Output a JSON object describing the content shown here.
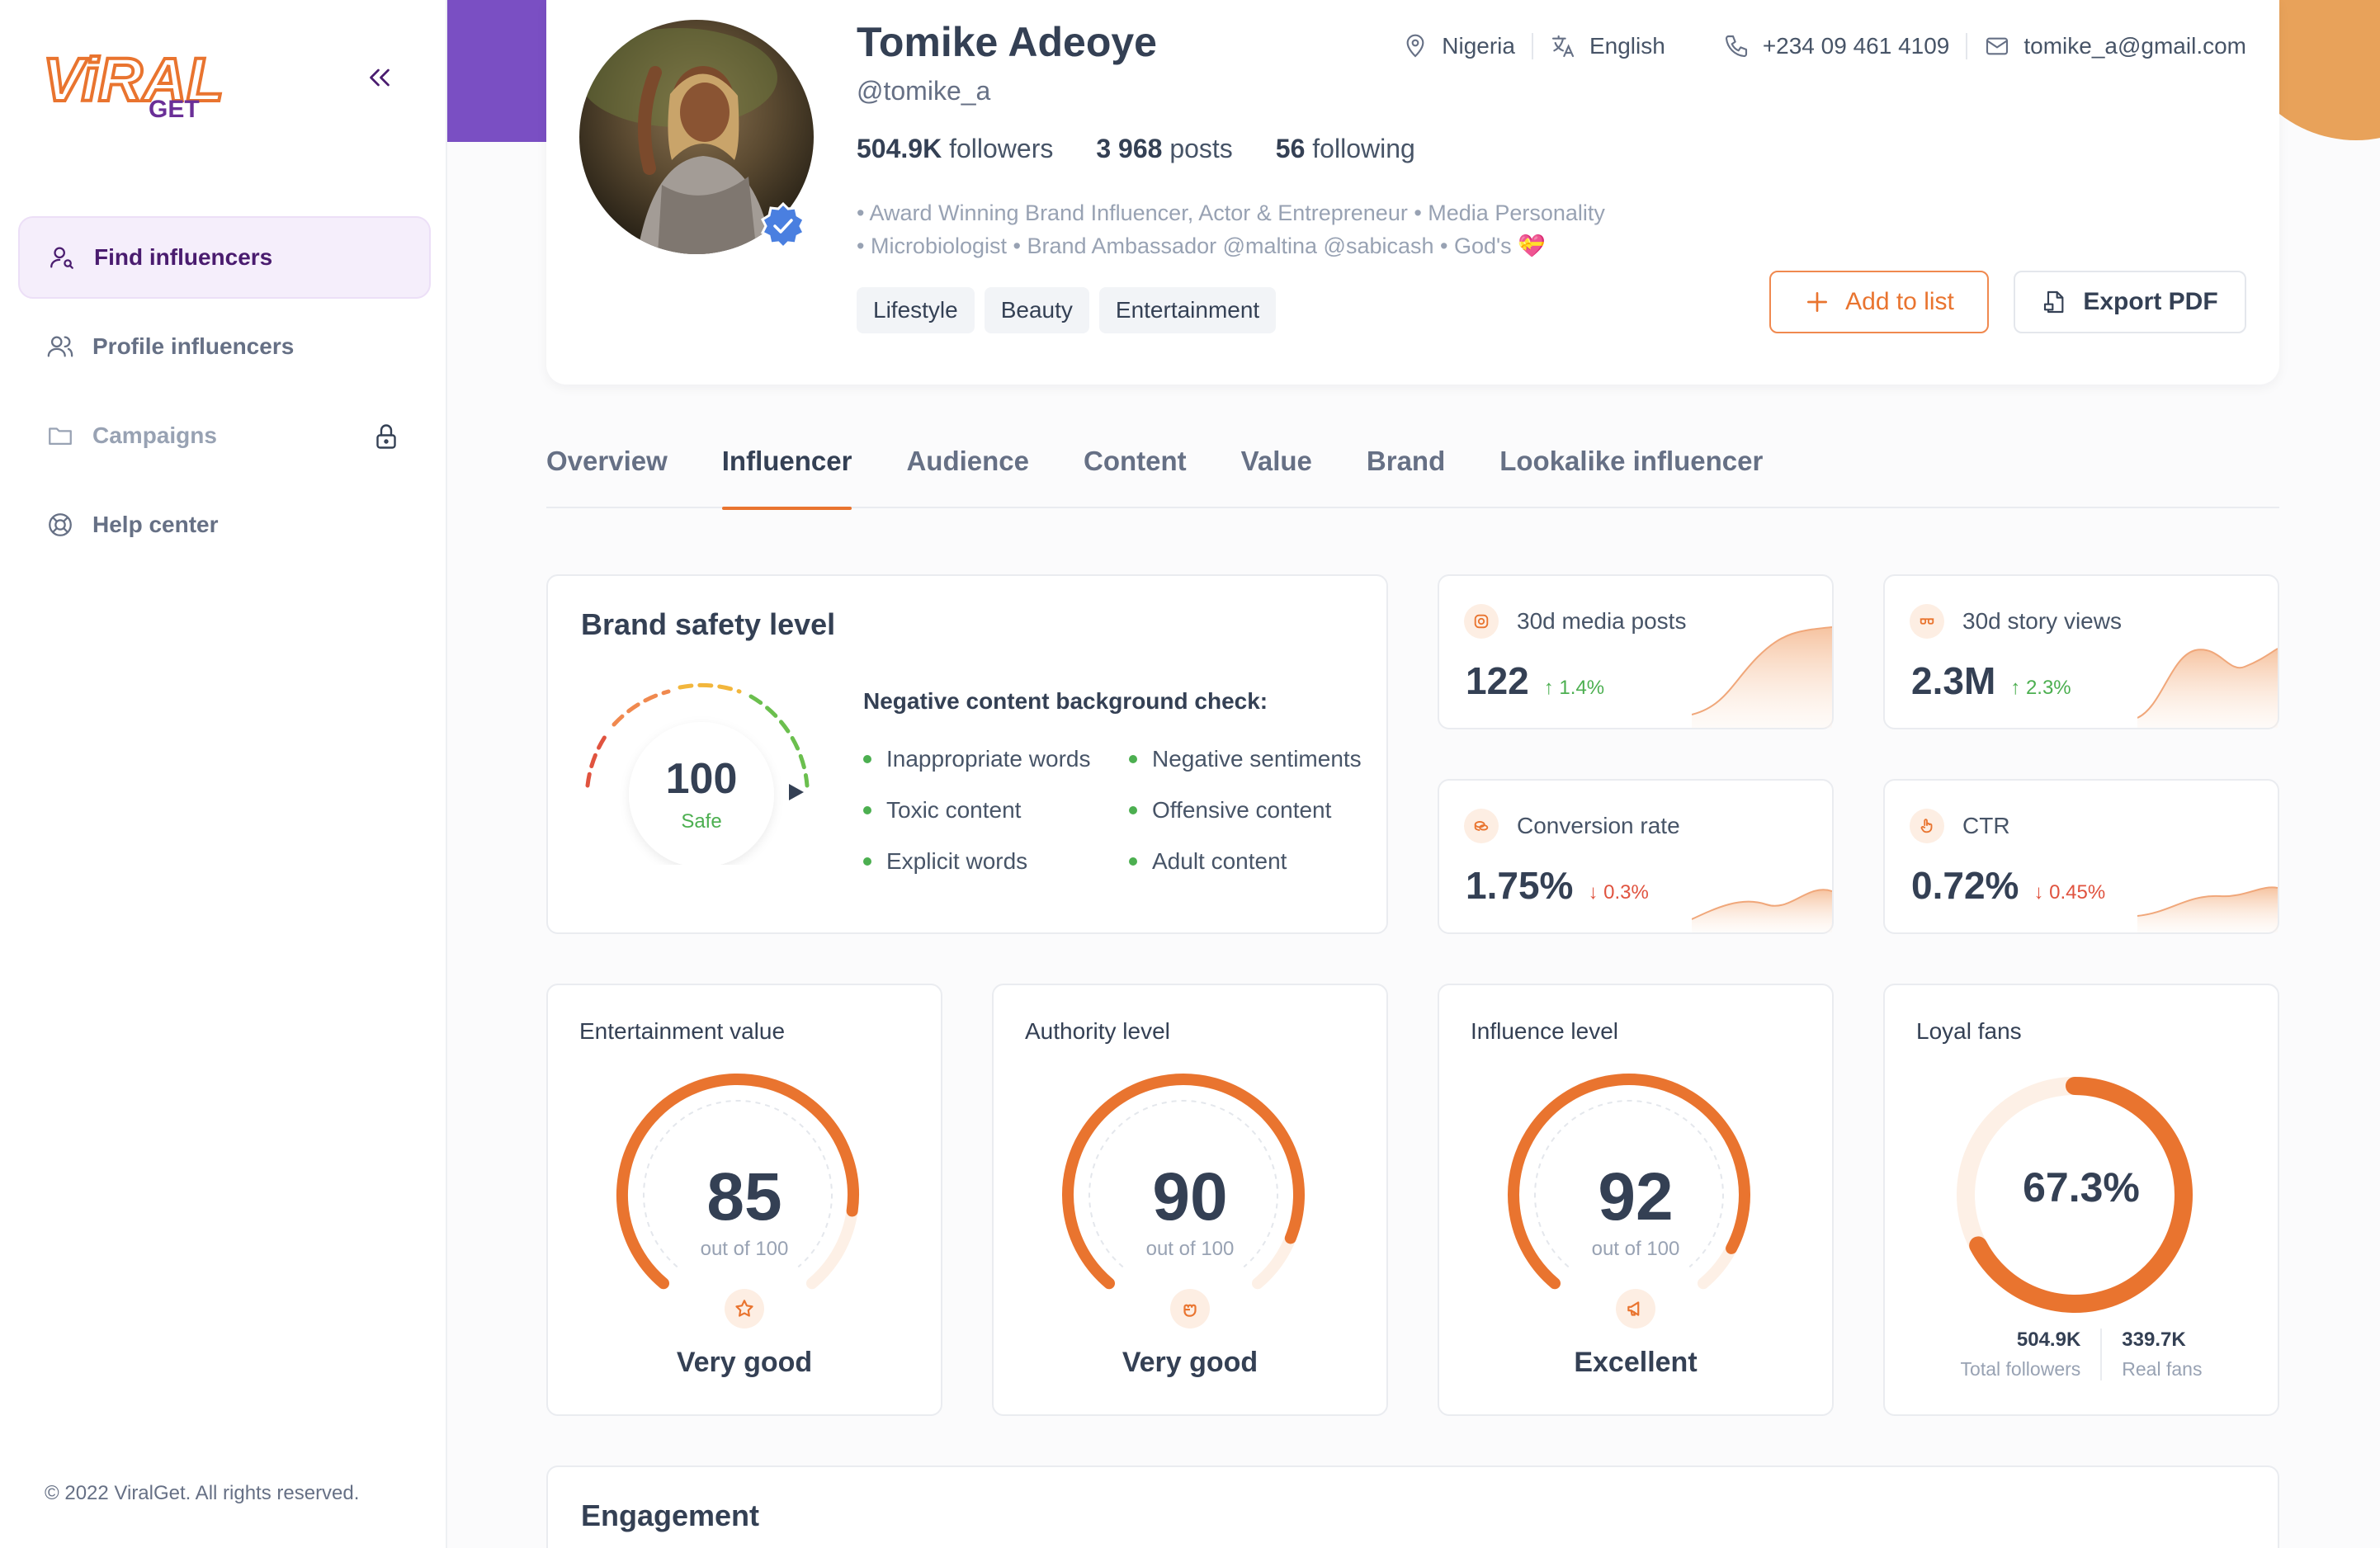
{
  "brand": {
    "logo_main": "ViRAL",
    "logo_sub": "GET"
  },
  "sidebar": {
    "items": [
      {
        "label": "Find influencers"
      },
      {
        "label": "Profile influencers"
      },
      {
        "label": "Campaigns"
      },
      {
        "label": "Help center"
      }
    ],
    "copyright": "© 2022 ViralGet. All rights reserved."
  },
  "profile": {
    "name": "Tomike Adeoye",
    "handle": "@tomike_a",
    "followers_value": "504.9K",
    "followers_label": "followers",
    "posts_value": "3 968",
    "posts_label": "posts",
    "following_value": "56",
    "following_label": "following",
    "bio_line1": "• Award Winning Brand Influencer, Actor & Entrepreneur • Media Personality",
    "bio_line2": "• Microbiologist • Brand Ambassador @maltina @sabicash • God's 💝",
    "tags": [
      "Lifestyle",
      "Beauty",
      "Entertainment"
    ],
    "country": "Nigeria",
    "language": "English",
    "phone": "+234 09 461 4109",
    "email": "tomike_a@gmail.com",
    "add_to_list": "Add to list",
    "export_pdf": "Export PDF"
  },
  "tabs": [
    "Overview",
    "Influencer",
    "Audience",
    "Content",
    "Value",
    "Brand",
    "Lookalike influencer"
  ],
  "brand_safety": {
    "title": "Brand safety level",
    "score": "100",
    "status": "Safe",
    "check_title": "Negative content background check:",
    "checks": [
      "Inappropriate words",
      "Negative sentiments",
      "Toxic content",
      "Offensive content",
      "Explicit words",
      "Adult content"
    ]
  },
  "stats": [
    {
      "label": "30d media posts",
      "value": "122",
      "delta": "1.4%",
      "direction": "up"
    },
    {
      "label": "30d story views",
      "value": "2.3M",
      "delta": "2.3%",
      "direction": "up"
    },
    {
      "label": "Conversion rate",
      "value": "1.75%",
      "delta": "0.3%",
      "direction": "down"
    },
    {
      "label": "CTR",
      "value": "0.72%",
      "delta": "0.45%",
      "direction": "down"
    }
  ],
  "metrics": [
    {
      "title": "Entertainment value",
      "value": 85,
      "sub": "out of 100",
      "rating": "Very good",
      "icon": "star-icon"
    },
    {
      "title": "Authority level",
      "value": 90,
      "sub": "out of 100",
      "rating": "Very good",
      "icon": "fist-icon"
    },
    {
      "title": "Influence level",
      "value": 92,
      "sub": "out of 100",
      "rating": "Excellent",
      "icon": "megaphone-icon"
    }
  ],
  "loyal": {
    "title": "Loyal fans",
    "percent": "67.3%",
    "fraction": 0.673,
    "total_value": "504.9K",
    "total_label": "Total followers",
    "real_value": "339.7K",
    "real_label": "Real fans"
  },
  "engagement": {
    "title": "Engagement"
  },
  "colors": {
    "accent": "#e9742f",
    "purple": "#7a4fc3",
    "green": "#4caf50",
    "red": "#e0533f"
  }
}
